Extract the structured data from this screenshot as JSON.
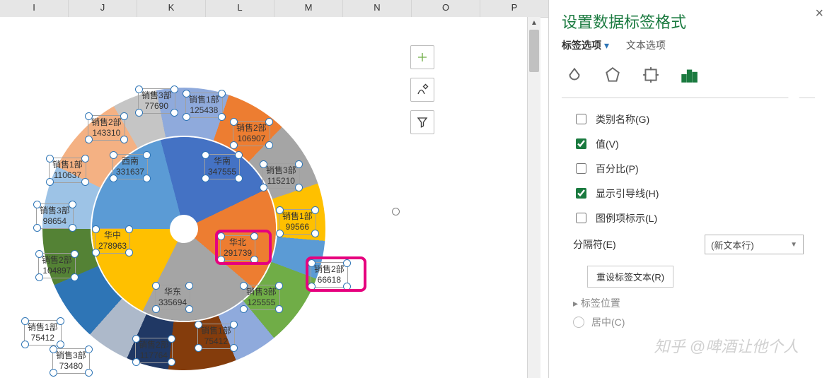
{
  "columns": [
    "I",
    "J",
    "K",
    "L",
    "M",
    "N",
    "O",
    "P"
  ],
  "chart_tools": {
    "plus": "add-element",
    "brush": "style",
    "funnel": "filter"
  },
  "panel": {
    "title": "设置数据标签格式",
    "tab1": "标签选项",
    "tab2": "文本选项",
    "opts": {
      "category": "类别名称(G)",
      "value": "值(V)",
      "percent": "百分比(P)",
      "leader": "显示引导线(H)",
      "legend": "图例项标示(L)"
    },
    "separator_label": "分隔符(E)",
    "separator_value": "(新文本行)",
    "reset": "重设标签文本(R)",
    "pos_header": "标签位置",
    "pos_center": "居中(C)"
  },
  "chart_data": {
    "type": "pie",
    "title": "",
    "inner": [
      {
        "name": "西南",
        "value": 331637,
        "color": "#5b9bd5"
      },
      {
        "name": "华南",
        "value": 347555,
        "color": "#4472c4"
      },
      {
        "name": "华北",
        "value": 291739,
        "color": "#ed7d31"
      },
      {
        "name": "华东",
        "value": 335694,
        "color": "#a5a5a5"
      },
      {
        "name": "华中",
        "value": 278963,
        "color": "#ffc000"
      }
    ],
    "outer": [
      {
        "name": "销售1部",
        "value": 110637,
        "parent": "西南",
        "color": "#9dc3e6"
      },
      {
        "name": "销售2部",
        "value": 143310,
        "parent": "西南",
        "color": "#f4b183"
      },
      {
        "name": "销售3部",
        "value": 77690,
        "parent": "西南",
        "color": "#c5c5c5"
      },
      {
        "name": "销售1部",
        "value": 125438,
        "parent": "华南",
        "color": "#8faadc"
      },
      {
        "name": "销售2部",
        "value": 106907,
        "parent": "华南",
        "color": "#ed7d31"
      },
      {
        "name": "销售3部",
        "value": 115210,
        "parent": "华南",
        "color": "#a5a5a5"
      },
      {
        "name": "销售1部",
        "value": 99566,
        "parent": "华北",
        "color": "#ffc000"
      },
      {
        "name": "销售2部",
        "value": 66618,
        "parent": "华北",
        "color": "#5b9bd5"
      },
      {
        "name": "销售3部",
        "value": 125555,
        "parent": "华北",
        "color": "#70ad47"
      },
      {
        "name": "销售1部",
        "value": 75412,
        "parent": "华东",
        "color": "#8faadc"
      },
      {
        "name": "销售2部",
        "value": 117764,
        "parent": "华东",
        "color": "#843c0c"
      },
      {
        "name": "销售3部",
        "value": 73480,
        "parent": "华东",
        "color": "#203864"
      },
      {
        "name": "销售1部",
        "value": 75412,
        "parent": "华中",
        "color": "#adb9ca"
      },
      {
        "name": "销售2部",
        "value": 104897,
        "parent": "华中",
        "color": "#2e75b6"
      },
      {
        "name": "销售3部",
        "value": 98654,
        "parent": "华中",
        "color": "#548235"
      }
    ]
  },
  "watermark": "知乎 @啤酒让他个人"
}
